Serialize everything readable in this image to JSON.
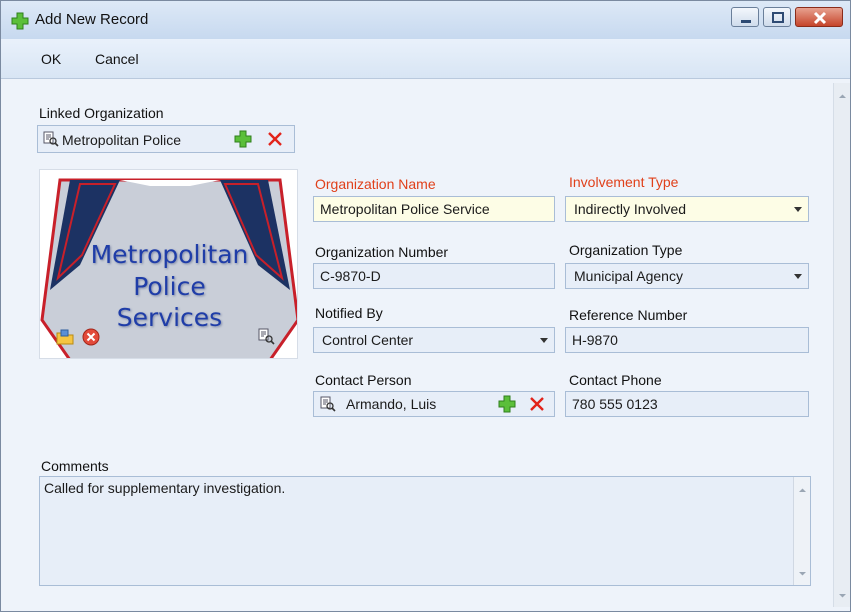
{
  "window": {
    "title": "Add New Record"
  },
  "menu": {
    "ok_label": "OK",
    "cancel_label": "Cancel"
  },
  "linked_organization": {
    "label": "Linked Organization",
    "value": "Metropolitan Police"
  },
  "logo": {
    "line1": "Metropolitan",
    "line2": "Police",
    "line3": "Services"
  },
  "fields": {
    "organization_name": {
      "label": "Organization Name",
      "value": "Metropolitan Police Service",
      "required": true
    },
    "involvement_type": {
      "label": "Involvement Type",
      "value": "Indirectly Involved",
      "required": true
    },
    "organization_number": {
      "label": "Organization Number",
      "value": "C-9870-D"
    },
    "organization_type": {
      "label": "Organization Type",
      "value": "Municipal Agency"
    },
    "notified_by": {
      "label": "Notified By",
      "value": "Control Center"
    },
    "reference_number": {
      "label": "Reference Number",
      "value": "H-9870"
    },
    "contact_person": {
      "label": "Contact Person",
      "value": "Armando, Luis"
    },
    "contact_phone": {
      "label": "Contact Phone",
      "value": "780 555 0123"
    }
  },
  "comments": {
    "label": "Comments",
    "value": "Called for supplementary investigation."
  },
  "colors": {
    "required_label": "#e0401a",
    "field_bg": "#e7eef8",
    "field_border": "#a9bdd6",
    "highlight_field_bg": "#fdfde6",
    "logo_blue": "#1f3da8",
    "logo_red": "#c8202a"
  },
  "icons": {
    "title_icon": "green-plus-icon",
    "lookup": "lookup-icon",
    "add": "green-plus-icon",
    "remove": "red-x-icon",
    "open": "folder-icon",
    "clear": "clear-icon",
    "dropdown": "chevron-down-icon"
  }
}
